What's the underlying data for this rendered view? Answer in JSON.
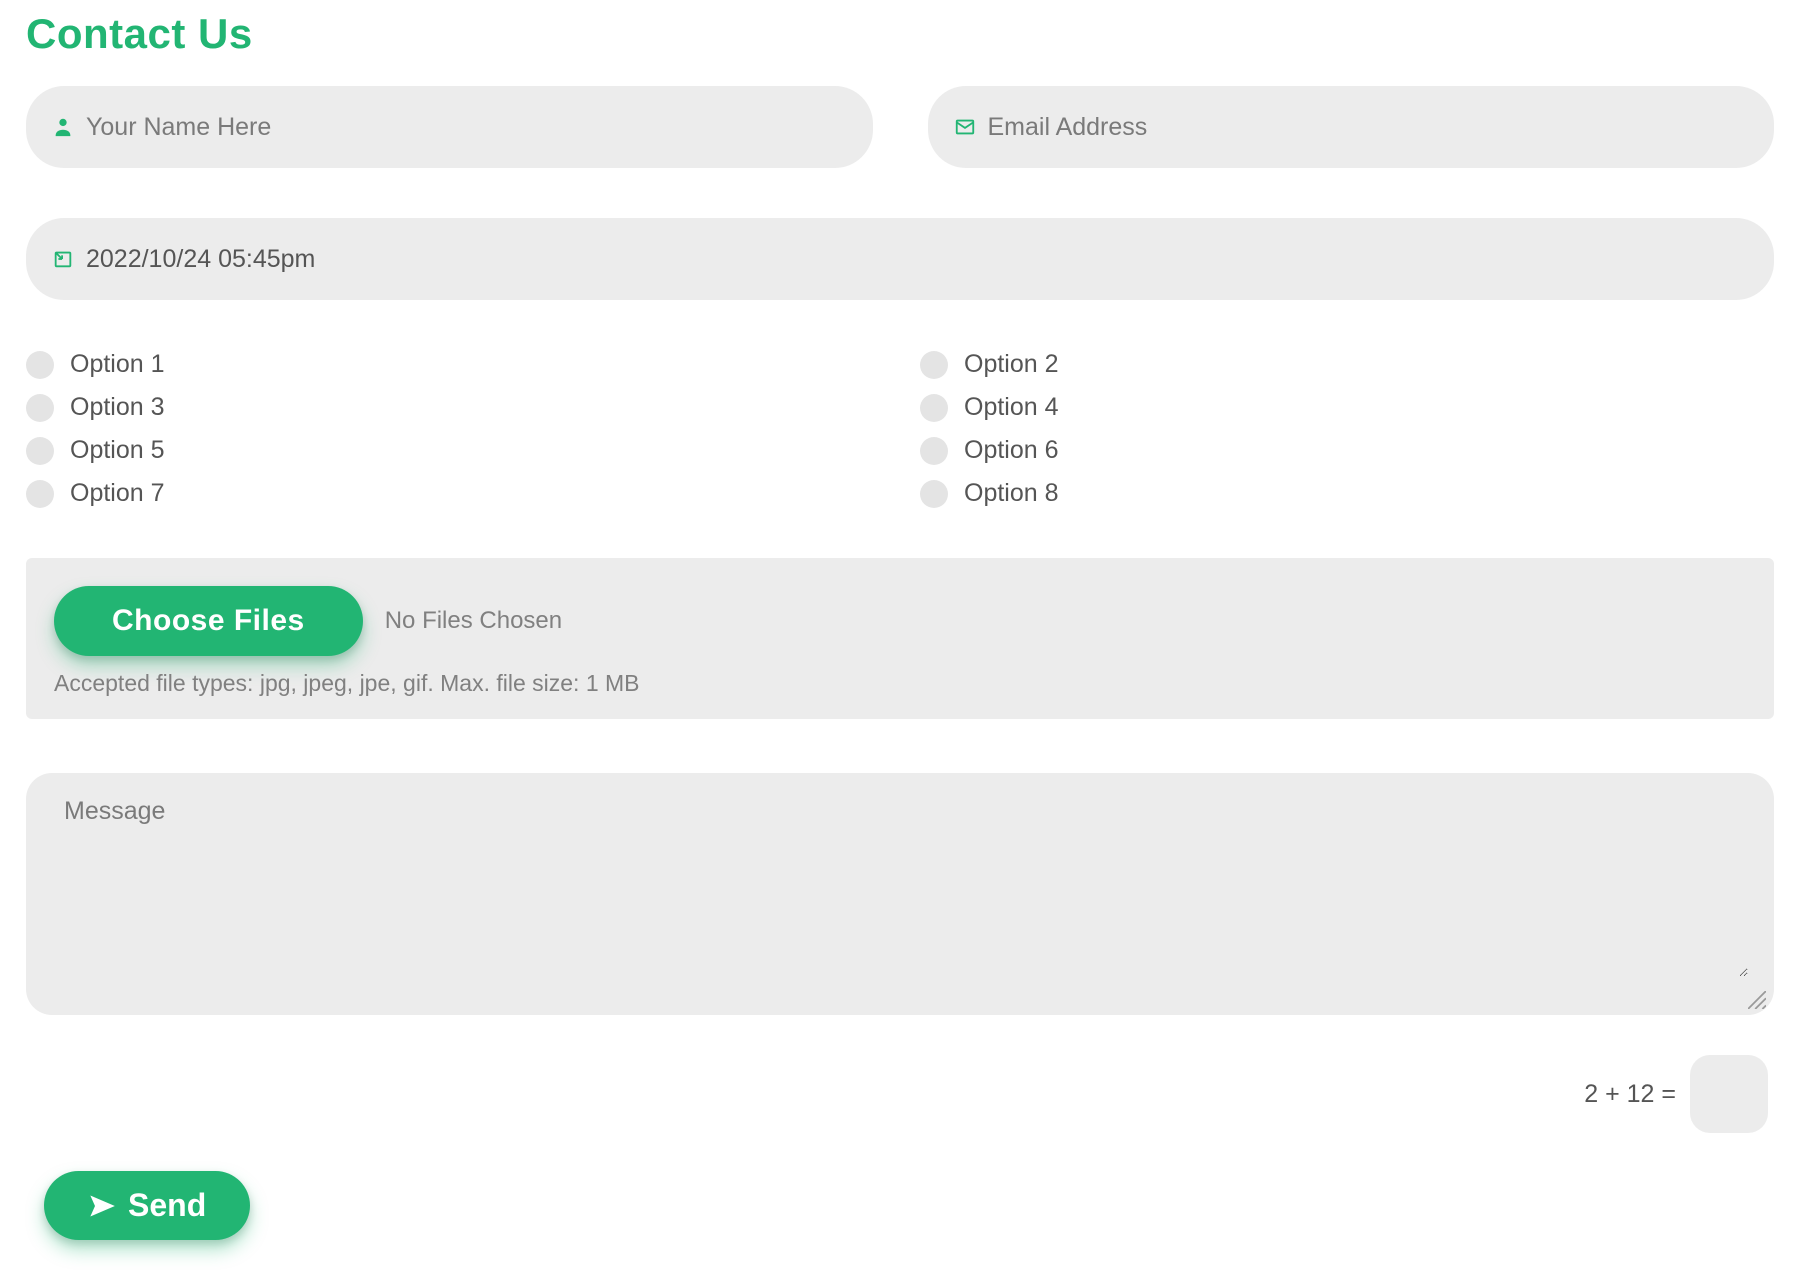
{
  "title": "Contact Us",
  "name_field": {
    "placeholder": "Your Name Here",
    "value": ""
  },
  "email_field": {
    "placeholder": "Email Address",
    "value": ""
  },
  "date_field": {
    "value": "2022/10/24 05:45pm"
  },
  "checkbox_options": [
    "Option 1",
    "Option 2",
    "Option 3",
    "Option 4",
    "Option 5",
    "Option 6",
    "Option 7",
    "Option 8"
  ],
  "file_upload": {
    "button_label": "Choose Files",
    "status": "No Files Chosen",
    "accepted_hint": "Accepted file types: jpg, jpeg, jpe, gif. Max. file size: 1 MB"
  },
  "message_field": {
    "placeholder": "Message",
    "value": ""
  },
  "captcha": {
    "question": "2 + 12 =",
    "value": ""
  },
  "submit_label": "Send",
  "colors": {
    "accent": "#22b573",
    "field_bg": "#ececec",
    "text": "#555555"
  }
}
